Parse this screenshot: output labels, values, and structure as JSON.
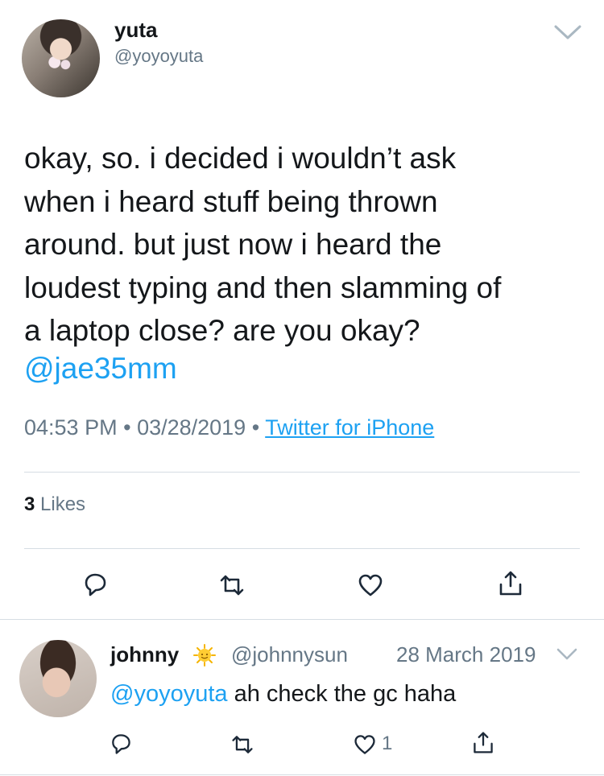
{
  "tweet": {
    "author_name": "yuta",
    "author_handle": "@yoyoyuta",
    "text": "okay, so. i decided i wouldn’t ask\nwhen i heard stuff being thrown\naround. but just now i heard the\nloudest typing and then slamming of\na laptop close? are you okay?",
    "mention": "@jae35mm",
    "time": "04:53 PM",
    "separator": "•",
    "date": "03/28/2019",
    "source": "Twitter for iPhone",
    "likes_count": "3",
    "likes_label": "Likes",
    "icons": {
      "menu": "chevron-down-icon",
      "reply": "reply-icon",
      "retweet": "retweet-icon",
      "like": "heart-icon",
      "share": "share-icon"
    }
  },
  "reply": {
    "author_name": "johnny",
    "badge_icon": "sun-emoji-icon",
    "author_handle": "@johnnysun",
    "date": "28 March 2019",
    "mention": "@yoyoyuta",
    "text": " ah check the gc haha",
    "like_count": "1"
  },
  "colors": {
    "link": "#1da1f2",
    "secondary_text": "#657786",
    "icon": "#1c2938",
    "divider": "#d6dde3"
  }
}
